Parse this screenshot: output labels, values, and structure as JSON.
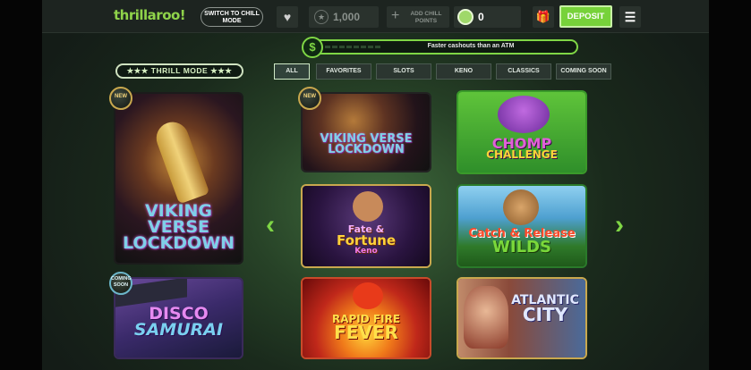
{
  "topbar": {
    "logo": "thrillaroo!",
    "chill_button": "SWITCH TO CHILL MODE",
    "favorites_icon": "heart-icon",
    "coins": "1,000",
    "chill_points": "ADD CHILL POINTS",
    "balance": "0",
    "gift_icon": "gift-icon",
    "deposit": "DEPOSIT",
    "menu_icon": "menu-icon"
  },
  "promo": {
    "text": "Faster cashouts than an ATM",
    "icon": "$"
  },
  "mode": {
    "label": "★★★ THRILL MODE ★★★"
  },
  "tabs": [
    {
      "label": "ALL",
      "active": true
    },
    {
      "label": "FAVORITES",
      "active": false
    },
    {
      "label": "SLOTS",
      "active": false
    },
    {
      "label": "KENO",
      "active": false
    },
    {
      "label": "CLASSICS",
      "active": false
    },
    {
      "label": "COMING SOON",
      "active": false
    }
  ],
  "games": [
    {
      "line1": "VIKING VERSE",
      "line2": "LOCKDOWN",
      "badge": "NEW"
    },
    {
      "line1": "VIKING VERSE",
      "line2": "LOCKDOWN",
      "badge": "NEW"
    },
    {
      "line1": "CHOMP",
      "line2": "CHALLENGE",
      "badge": ""
    },
    {
      "line1": "Fate &",
      "line2": "Fortune",
      "line3": "Keno",
      "badge": ""
    },
    {
      "line1": "Catch & Release",
      "line2": "WILDS",
      "badge": ""
    },
    {
      "line1": "DISCO",
      "line2": "SAMURAI",
      "badge": "COMING SOON"
    },
    {
      "line1": "RAPID FIRE",
      "line2": "FEVER",
      "badge": ""
    },
    {
      "line1": "ATLANTIC",
      "line2": "CITY",
      "badge": ""
    }
  ],
  "nav": {
    "prev": "‹",
    "next": "›"
  },
  "colors": {
    "accent": "#7fd645",
    "bar": "#1d2420"
  }
}
